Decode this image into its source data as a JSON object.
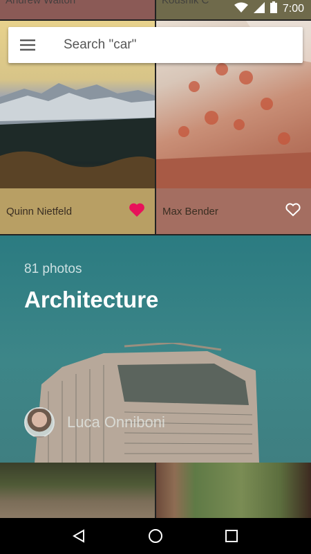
{
  "status": {
    "time": "7:00"
  },
  "top_row": {
    "left_name": "Andrew Walton",
    "right_name": "Koushik C"
  },
  "search": {
    "placeholder": "Search \"car\""
  },
  "cards": [
    {
      "author": "Quinn Nietfeld",
      "liked": true,
      "color": "#b89f64"
    },
    {
      "author": "Max Bender",
      "liked": false,
      "color": "#a46e61"
    }
  ],
  "collection": {
    "photo_count": "81 photos",
    "title": "Architecture",
    "author": "Luca Onniboni",
    "color": "#2f7d83"
  },
  "colors": {
    "heart_active": "#e8115a",
    "heart_inactive": "#ffffff"
  }
}
